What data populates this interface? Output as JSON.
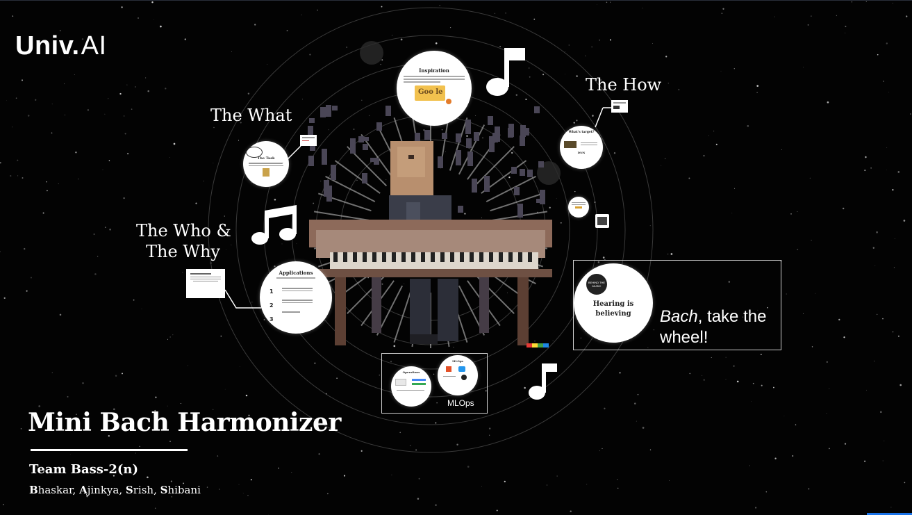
{
  "brand": {
    "name": "Univ.",
    "suffix": "AI"
  },
  "sections": {
    "what": "The What",
    "how": "The  How",
    "who_line1": "The  Who &",
    "who_line2": "The Why"
  },
  "cards": {
    "inspiration": {
      "title": "Inspiration",
      "google_text": "Goo le"
    },
    "task": {
      "title": "The Task"
    },
    "whats_target": {
      "title": "What's target?",
      "subtitle": "DNN"
    },
    "applications": {
      "title": "Applications",
      "nums": [
        "1",
        "2",
        "3"
      ]
    },
    "hearing": {
      "badge": "BEHIND THE MUSIC",
      "line1": "Hearing is",
      "line2": "believing"
    },
    "operations": {
      "title": "Operations"
    },
    "mlops_inner": {
      "title": "MLOps"
    }
  },
  "callout": {
    "emph": "Bach",
    "rest": ", take the",
    "line2": "wheel!"
  },
  "mlops_label": "MLOps",
  "presentation": {
    "title": "Mini Bach Harmonizer",
    "team": "Team Bass-2(n)",
    "members": [
      {
        "initial": "B",
        "rest": "haskar"
      },
      {
        "initial": "A",
        "rest": "jinkya"
      },
      {
        "initial": "S",
        "rest": "rish"
      },
      {
        "initial": "S",
        "rest": "hibani"
      }
    ]
  },
  "colors": {
    "background": "#030303",
    "text": "#ffffff",
    "accent": "#f2c14e"
  }
}
